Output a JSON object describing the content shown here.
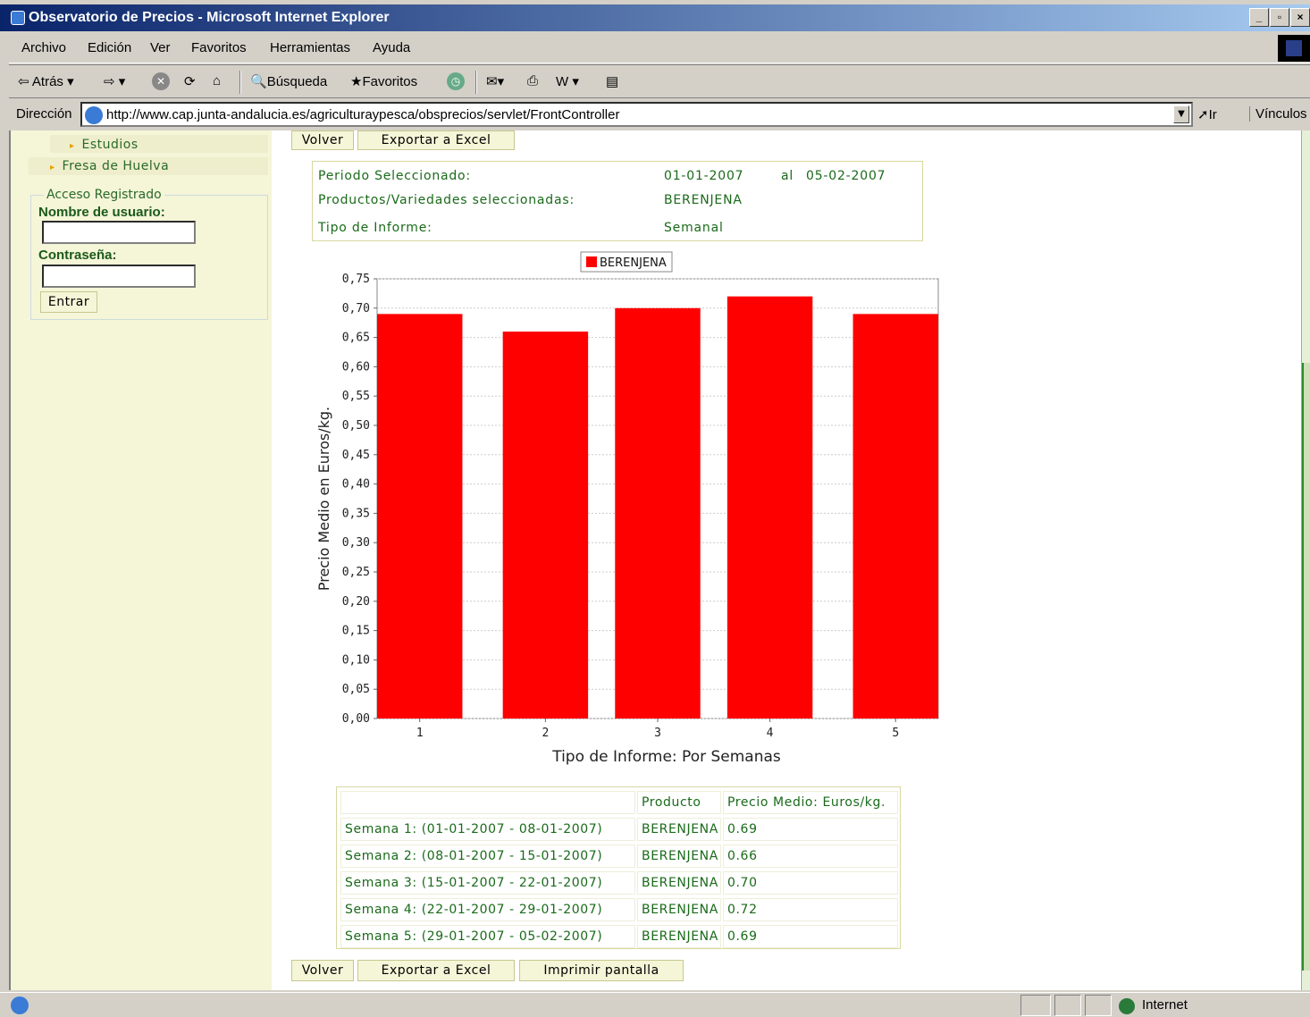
{
  "window": {
    "title": "Observatorio de Precios - Microsoft Internet Explorer",
    "buttons": [
      "_",
      "▫",
      "×"
    ]
  },
  "menu": [
    "Archivo",
    "Edición",
    "Ver",
    "Favoritos",
    "Herramientas",
    "Ayuda"
  ],
  "toolbar": {
    "back": "Atrás",
    "search": "Búsqueda",
    "favorites": "Favoritos"
  },
  "address": {
    "label": "Dirección",
    "url": "http://www.cap.junta-andalucia.es/agriculturaypesca/obsprecios/servlet/FrontController",
    "go": "Ir",
    "links": "Vínculos"
  },
  "sidebar": {
    "items": [
      "Estudios",
      "Fresa de Huelva"
    ],
    "login": {
      "legend": "Acceso Registrado",
      "user_label": "Nombre de usuario:",
      "user_value": "",
      "pass_label": "Contraseña:",
      "pass_value": "",
      "submit": "Entrar"
    }
  },
  "actions_top": {
    "back": "Volver",
    "excel": "Exportar a Excel"
  },
  "info": {
    "period_label": "Periodo Seleccionado:",
    "period_from": "01-01-2007",
    "period_sep": "al",
    "period_to": "05-02-2007",
    "products_label": "Productos/Variedades seleccionadas:",
    "products_value": "BERENJENA",
    "type_label": "Tipo de Informe:",
    "type_value": "Semanal"
  },
  "chart_data": {
    "type": "bar",
    "categories": [
      "1",
      "2",
      "3",
      "4",
      "5"
    ],
    "series": [
      {
        "name": "BERENJENA",
        "values": [
          0.69,
          0.66,
          0.7,
          0.72,
          0.69
        ],
        "color": "#ff0000"
      }
    ],
    "xlabel": "Tipo de Informe: Por Semanas",
    "ylabel": "Precio Medio en Euros/kg.",
    "ylim": [
      0,
      0.75
    ],
    "yticks": [
      "0,00",
      "0,05",
      "0,10",
      "0,15",
      "0,20",
      "0,25",
      "0,30",
      "0,35",
      "0,40",
      "0,45",
      "0,50",
      "0,55",
      "0,60",
      "0,65",
      "0,70",
      "0,75"
    ],
    "legend": "top-center",
    "grid": true
  },
  "table": {
    "headers": [
      "",
      "Producto",
      "Precio Medio: Euros/kg."
    ],
    "rows": [
      [
        "Semana 1: (01-01-2007 - 08-01-2007)",
        "BERENJENA",
        "0.69"
      ],
      [
        "Semana 2: (08-01-2007 - 15-01-2007)",
        "BERENJENA",
        "0.66"
      ],
      [
        "Semana 3: (15-01-2007 - 22-01-2007)",
        "BERENJENA",
        "0.70"
      ],
      [
        "Semana 4: (22-01-2007 - 29-01-2007)",
        "BERENJENA",
        "0.72"
      ],
      [
        "Semana 5: (29-01-2007 - 05-02-2007)",
        "BERENJENA",
        "0.69"
      ]
    ]
  },
  "actions_bottom": {
    "back": "Volver",
    "excel": "Exportar a Excel",
    "print": "Imprimir pantalla"
  },
  "status": {
    "zone": "Internet"
  }
}
